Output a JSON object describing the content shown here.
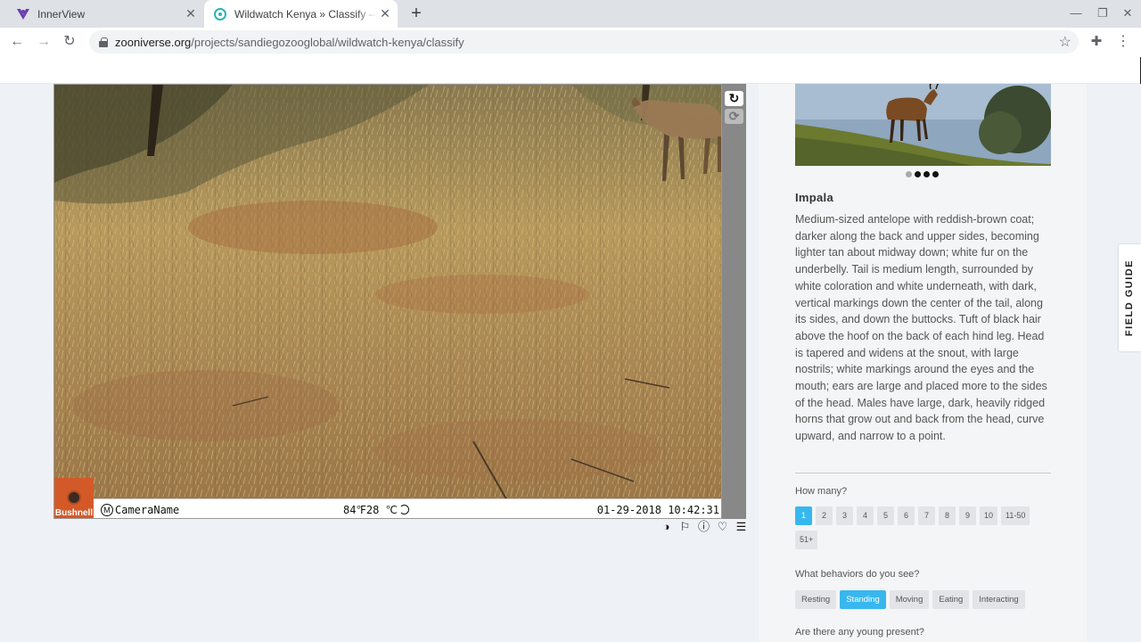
{
  "browser": {
    "tabs": [
      {
        "title": "InnerView",
        "active": false
      },
      {
        "title": "Wildwatch Kenya » Classify — Zo",
        "active": true
      }
    ],
    "url_host": "zooniverse.org",
    "url_path": "/projects/sandiegozooglobal/wildwatch-kenya/classify"
  },
  "camera": {
    "brand": "Bushnell",
    "camera_name": "CameraName",
    "temperature": "84℉28 ℃",
    "timestamp": "01-29-2018 10:42:31"
  },
  "field_guide": {
    "species": "Impala",
    "image_dots": 4,
    "active_dot": 0,
    "description": "Medium-sized antelope with reddish-brown coat; darker along the back and upper sides, becoming lighter tan about midway down; white fur on the underbelly. Tail is medium length, surrounded by white coloration and white underneath, with dark, vertical markings down the center of the tail, along its sides, and down the buttocks. Tuft of black hair above the hoof on the back of each hind leg. Head is tapered and widens at the snout, with large nostrils; white markings around the eyes and the mouth; ears are large and placed more to the sides of the head. Males have large, dark, heavily ridged horns that grow out and back from the head, curve upward, and narrow to a point.",
    "tab_label": "FIELD GUIDE"
  },
  "questions": {
    "how_many": {
      "label": "How many?",
      "options": [
        "1",
        "2",
        "3",
        "4",
        "5",
        "6",
        "7",
        "8",
        "9",
        "10",
        "11-50",
        "51+"
      ],
      "selected": "1"
    },
    "behaviors": {
      "label": "What behaviors do you see?",
      "options": [
        "Resting",
        "Standing",
        "Moving",
        "Eating",
        "Interacting"
      ],
      "selected": "Standing"
    },
    "young": {
      "label": "Are there any young present?"
    }
  },
  "colors": {
    "accent": "#38b7ef",
    "bushnell_orange": "#d35a28"
  }
}
